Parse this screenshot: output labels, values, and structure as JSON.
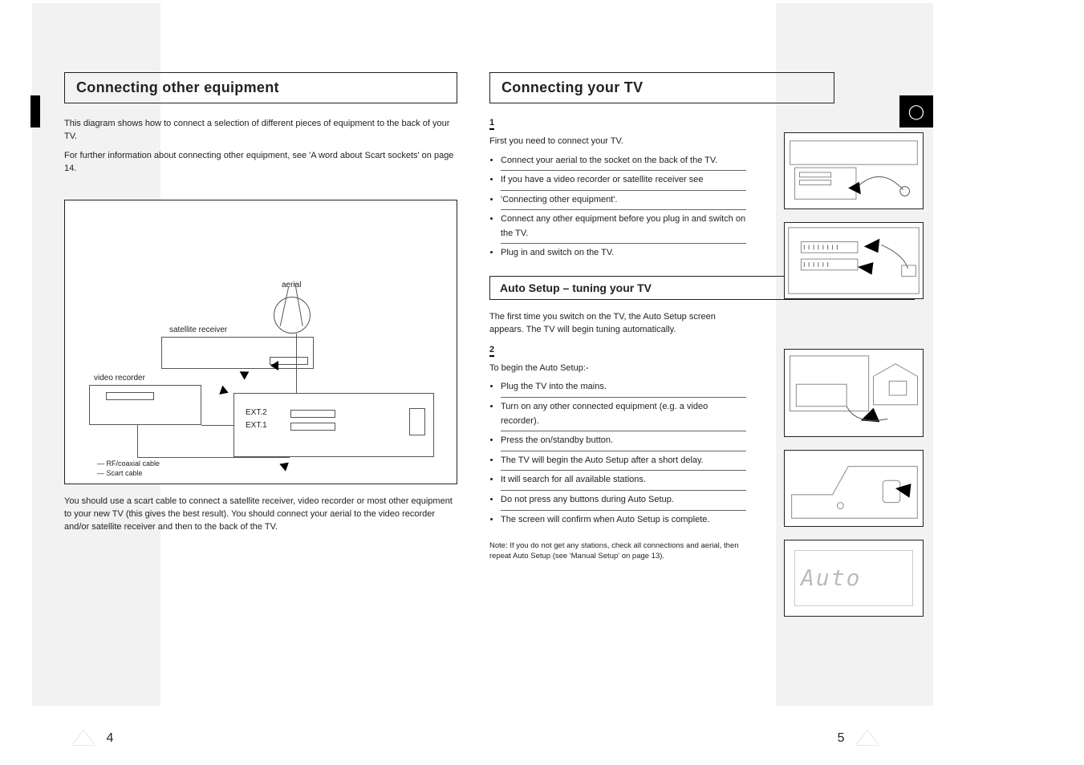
{
  "tab_right_icon": "◯",
  "left": {
    "heading": "Connecting other equipment",
    "intro1": "This diagram shows how to connect a selection of different pieces of equipment to the back of your TV.",
    "intro2": "For further information about connecting other equipment, see 'A word about Scart sockets' on page 14.",
    "diagram": {
      "top_label": "aerial",
      "sat_label": "satellite receiver",
      "vcr_label": "video recorder",
      "ext2_label": "EXT.2",
      "ext1_label": "EXT.1",
      "legend_rf": "— RF/coaxial cable",
      "legend_scart": "— Scart cable"
    },
    "scart_note": "You should use a scart cable to connect a satellite receiver, video recorder or most other equipment to your new TV (this gives the best result). You should connect your aerial to the video recorder and/or satellite receiver and then to the back of the TV."
  },
  "right": {
    "heading": "Connecting your TV",
    "step1_num": "1",
    "step1_text": "First you need to connect your TV.",
    "step1_bullets": [
      "Connect your aerial to the socket on the back of the TV.",
      "If you have a video recorder or satellite receiver see",
      "'Connecting other equipment'.",
      "Connect any other equipment before you plug in and switch on the TV.",
      "Plug in and switch on the TV."
    ],
    "subheading": "Auto Setup – tuning your TV",
    "setup_intro": "The first time you switch on the TV, the Auto Setup screen appears. The TV will begin tuning automatically.",
    "step2_num": "2",
    "step2_text": "To begin the Auto Setup:-",
    "step2_bullets": [
      "Plug the TV into the mains.",
      "Turn on any other connected equipment (e.g. a video recorder).",
      "Press the on/standby button.",
      "The TV will begin the Auto Setup after a short delay.",
      "It will search for all available stations.",
      "Do not press any buttons during Auto Setup.",
      "The screen will confirm when Auto Setup is complete."
    ],
    "note": "Note: If you do not get any stations, check all connections and aerial, then repeat Auto Setup (see 'Manual Setup' on page 13)."
  },
  "figures": {
    "display_text": "Auto"
  },
  "footer": {
    "page_left": "4",
    "page_right": "5"
  }
}
